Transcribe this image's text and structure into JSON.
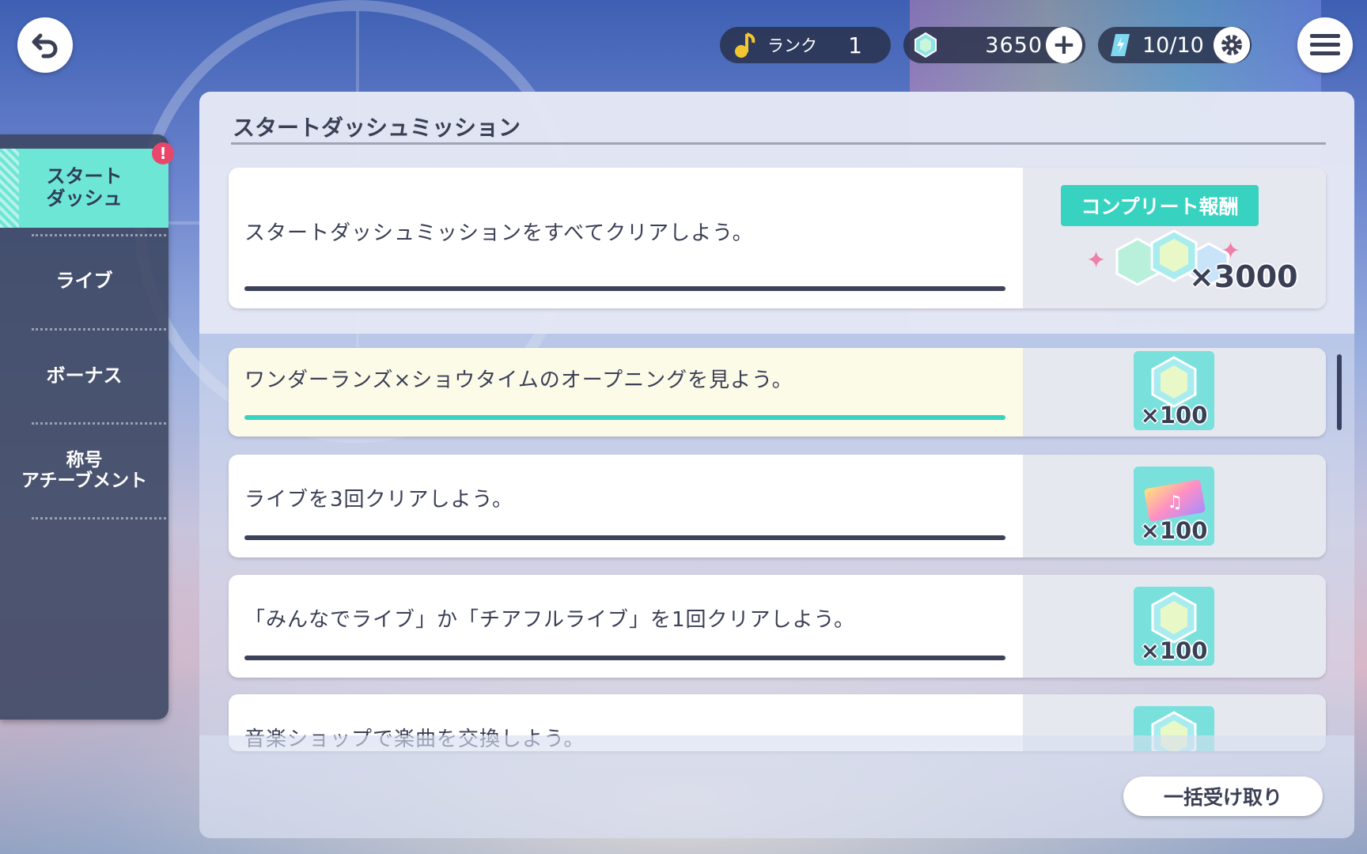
{
  "top_bar": {
    "rank_label": "ランク",
    "rank_value": "1",
    "gems": "3650",
    "energy": "10/10"
  },
  "sidebar": {
    "items": [
      {
        "label": "スタート\nダッシュ",
        "active": true,
        "badge": "!"
      },
      {
        "label": "ライブ",
        "active": false
      },
      {
        "label": "ボーナス",
        "active": false
      },
      {
        "label": "称号\nアチーブメント",
        "active": false
      }
    ]
  },
  "panel": {
    "title": "スタートダッシュミッション",
    "complete": {
      "text": "スタートダッシュミッションをすべてクリアしよう。",
      "reward_banner": "コンプリート報酬",
      "reward_qty": "×3000",
      "reward_icon": "gem-icon"
    },
    "missions": [
      {
        "text": "ワンダーランズ×ショウタイムのオープニングを見よう。",
        "reward_icon": "gem-icon",
        "reward_qty": "×100",
        "progress": 1.0,
        "highlight": true
      },
      {
        "text": "ライブを3回クリアしよう。",
        "reward_icon": "live-ticket-icon",
        "reward_qty": "×100",
        "progress": 0,
        "highlight": false
      },
      {
        "text": "「みんなでライブ」か「チアフルライブ」を1回クリアしよう。",
        "reward_icon": "gem-icon",
        "reward_qty": "×100",
        "progress": 0,
        "highlight": false
      },
      {
        "text": "音楽ショップで楽曲を交換しよう。",
        "reward_icon": "gem-icon",
        "reward_qty": "",
        "progress": 0,
        "highlight": false
      }
    ],
    "claim_all_label": "一括受け取り"
  },
  "colors": {
    "accent": "#38d2c0",
    "active_tab": "#6ee6d6",
    "dark_text": "#3a3f55",
    "badge": "#e8466a"
  }
}
